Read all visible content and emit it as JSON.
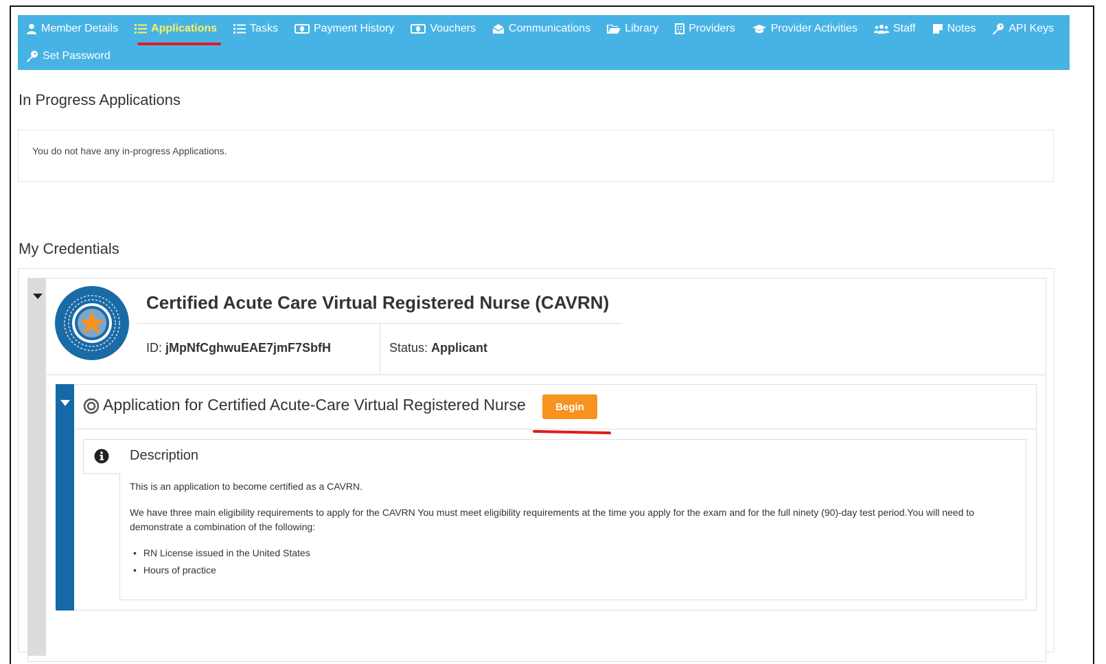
{
  "nav": {
    "row1": [
      {
        "id": "member-details",
        "label": "Member Details",
        "icon": "user-icon"
      },
      {
        "id": "applications",
        "label": "Applications",
        "icon": "list-icon",
        "active": true
      },
      {
        "id": "tasks",
        "label": "Tasks",
        "icon": "list-icon"
      },
      {
        "id": "payment-history",
        "label": "Payment History",
        "icon": "money-icon"
      },
      {
        "id": "vouchers",
        "label": "Vouchers",
        "icon": "money-icon"
      },
      {
        "id": "communications",
        "label": "Communications",
        "icon": "envelope-open-icon"
      },
      {
        "id": "library",
        "label": "Library",
        "icon": "folder-open-icon"
      },
      {
        "id": "providers",
        "label": "Providers",
        "icon": "building-icon"
      },
      {
        "id": "provider-activities",
        "label": "Provider Activities",
        "icon": "graduation-cap-icon"
      },
      {
        "id": "staff",
        "label": "Staff",
        "icon": "users-icon"
      },
      {
        "id": "notes",
        "label": "Notes",
        "icon": "sticky-note-icon"
      },
      {
        "id": "api-keys",
        "label": "API Keys",
        "icon": "key-icon"
      }
    ],
    "row2": [
      {
        "id": "set-password",
        "label": "Set Password",
        "icon": "key-icon"
      }
    ],
    "colors": {
      "bar": "#47b3e5",
      "active": "#fff25a"
    }
  },
  "in_progress": {
    "title": "In Progress Applications",
    "empty_message": "You do not have any in-progress Applications."
  },
  "credentials": {
    "title": "My Credentials",
    "name": "Certified Acute Care Virtual Registered Nurse (CAVRN)",
    "id_label": "ID:",
    "id_value": "jMpNfCghwuEAE7jmF7SbfH",
    "status_label": "Status:",
    "status_value": "Applicant",
    "application": {
      "title": "Application for Certified Acute-Care Virtual Registered Nurse",
      "begin_label": "Begin",
      "description_label": "Description",
      "description_p1": "This is an application to become certified as a CAVRN.",
      "description_p2": "We have three main eligibility requirements to apply for the CAVRN You must meet eligibility requirements at the time you apply for the exam and for the full ninety (90)-day test period.You will need to demonstrate a combination of the following:",
      "requirements": [
        "RN License issued in the United States",
        "Hours of practice"
      ]
    }
  },
  "colors": {
    "begin": "#f7931e",
    "app_bar": "#1569a7",
    "badge": "#1a6aa6",
    "annotation": "#e21a1a"
  }
}
